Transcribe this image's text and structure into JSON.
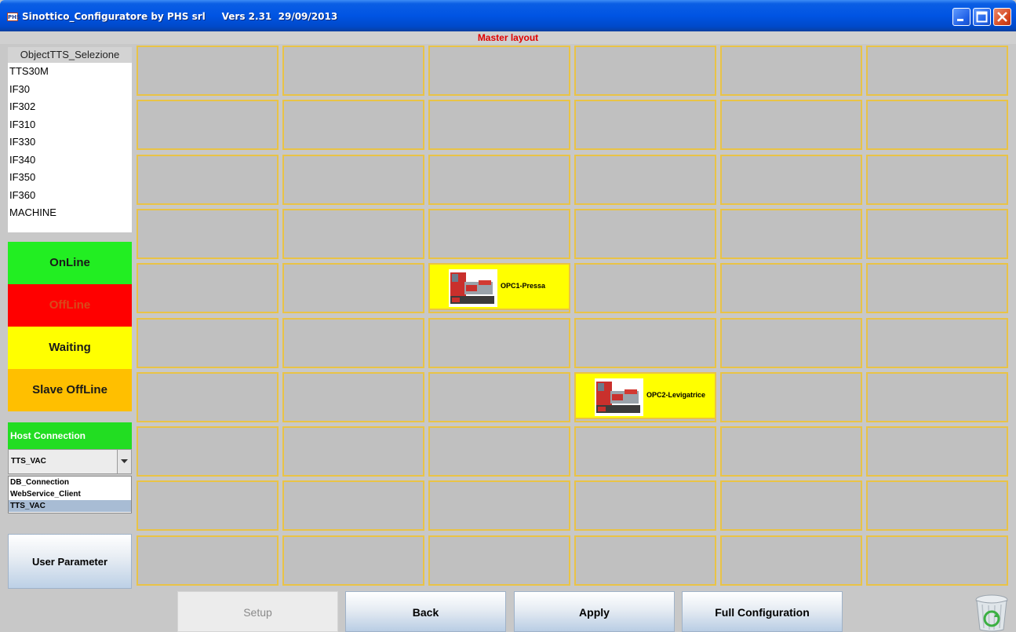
{
  "window": {
    "app_icon_text": "PHS",
    "title": "Sinottico_Configuratore by PHS srl     Vers 2.31  29/09/2013"
  },
  "layout_title": "Master layout",
  "left_panel": {
    "list_header": "ObjectTTS_Selezione",
    "objects": [
      "TTS30M",
      "IF30",
      "IF302",
      "IF310",
      "IF330",
      "IF340",
      "IF350",
      "IF360",
      "MACHINE"
    ],
    "status_legend": [
      {
        "label": "OnLine",
        "bg": "#22ee22",
        "color": "#1a1a1a"
      },
      {
        "label": "OffLine",
        "bg": "#ff0000",
        "color": "#d84a1a"
      },
      {
        "label": "Waiting",
        "bg": "#ffff00",
        "color": "#1a1a1a"
      },
      {
        "label": "Slave OffLine",
        "bg": "#ffbf00",
        "color": "#1a1a1a"
      }
    ],
    "host_connection_label": "Host Connection",
    "host_combo_value": "TTS_VAC",
    "host_options": [
      "DB_Connection",
      "WebService_Client",
      "TTS_VAC"
    ],
    "host_selected": "TTS_VAC",
    "user_parameter_label": "User Parameter"
  },
  "grid": {
    "rows": 10,
    "cols": 6,
    "machines": [
      {
        "row": 4,
        "col": 2,
        "label": "OPC1-Pressa",
        "icon": "lathe-machine-icon"
      },
      {
        "row": 6,
        "col": 3,
        "label": "OPC2-Levigatrice",
        "icon": "lathe-machine-icon"
      }
    ]
  },
  "buttons": {
    "setup": "Setup",
    "back": "Back",
    "apply": "Apply",
    "full_configuration": "Full Configuration"
  },
  "colors": {
    "accent_title": "#e00000",
    "cell_border": "#e9c346",
    "machine_bg": "#ffff00"
  }
}
